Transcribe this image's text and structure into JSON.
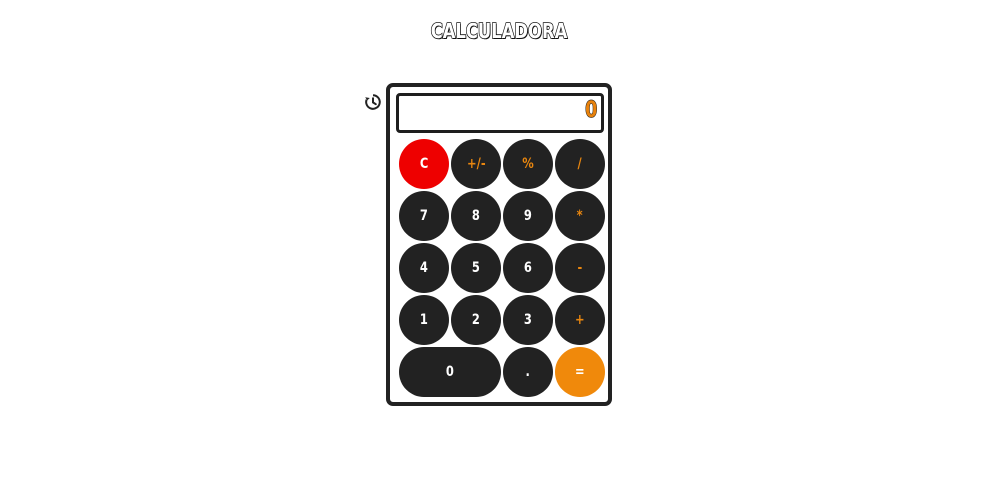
{
  "header": {
    "title": "CALCULADORA"
  },
  "history": {
    "icon": "history-icon"
  },
  "display": {
    "value": "0"
  },
  "keypad": {
    "clear": "C",
    "sign": "+/-",
    "percent": "%",
    "divide": "/",
    "seven": "7",
    "eight": "8",
    "nine": "9",
    "multiply": "*",
    "four": "4",
    "five": "5",
    "six": "6",
    "subtract": "-",
    "one": "1",
    "two": "2",
    "three": "3",
    "add": "+",
    "zero": "0",
    "decimal": ".",
    "equals": "="
  },
  "colors": {
    "button_dark": "#222222",
    "operator_text": "#e8860f",
    "clear_button": "#ee0000",
    "equals_button": "#f0890b"
  }
}
